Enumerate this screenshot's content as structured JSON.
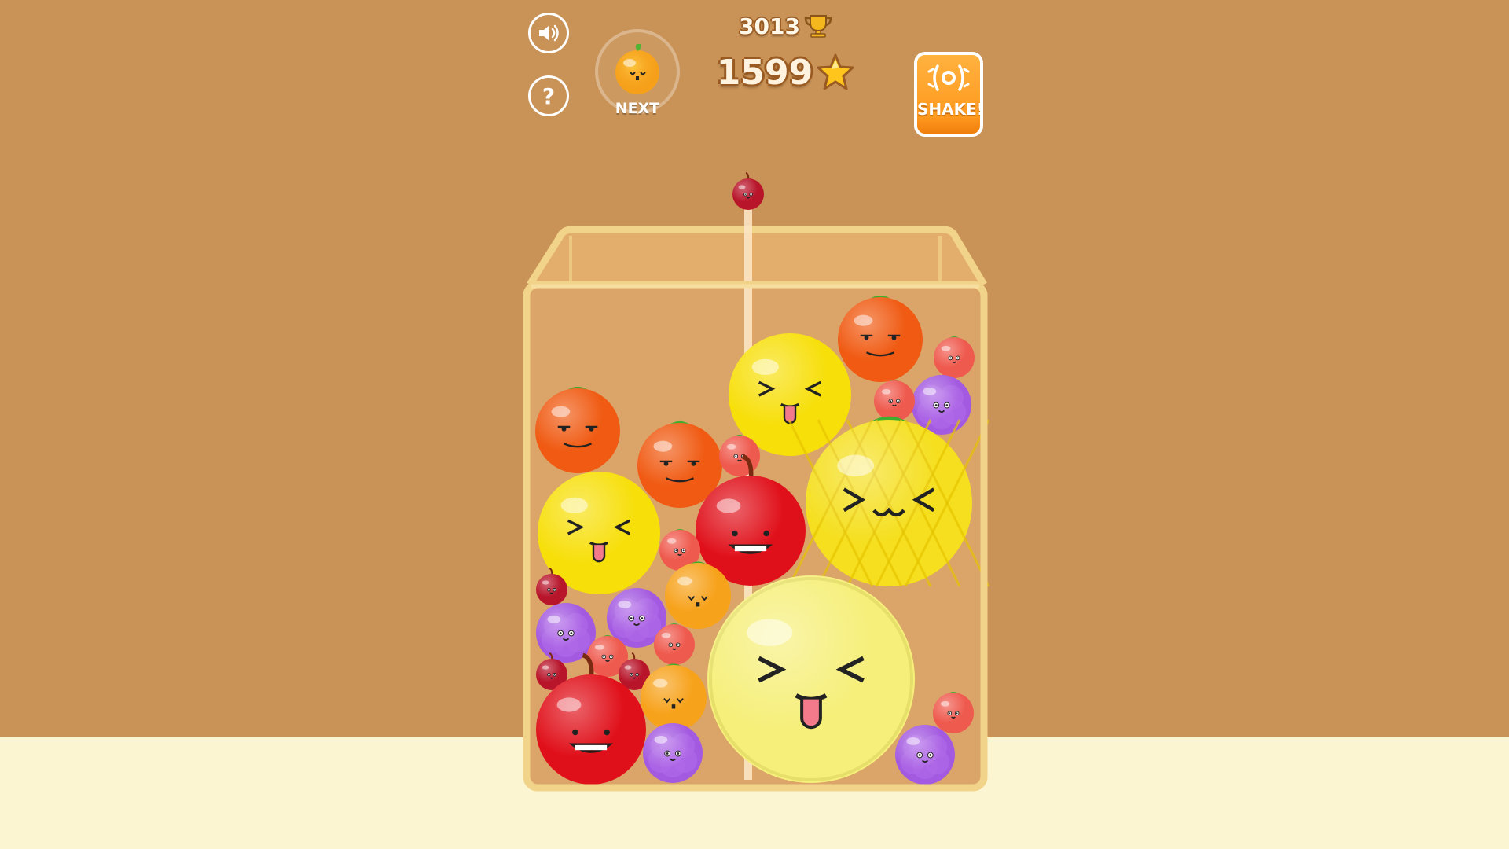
{
  "hud": {
    "best_score": "3013",
    "score": "1599",
    "next_label": "NEXT",
    "next_fruit": "orange",
    "shake_label": "SHAKE!",
    "sound_icon": "speaker-icon",
    "help_icon": "question-icon"
  },
  "dropper": {
    "fruit": "cherry"
  },
  "jar": {
    "fruits": [
      {
        "kind": "orange",
        "face": "smug"
      },
      {
        "kind": "orange",
        "face": "smug"
      },
      {
        "kind": "lemon",
        "face": "tongue"
      },
      {
        "kind": "orange",
        "face": "smug"
      },
      {
        "kind": "strawberry",
        "face": "happy"
      },
      {
        "kind": "grape",
        "face": "happy"
      },
      {
        "kind": "strawberry",
        "face": "happy"
      },
      {
        "kind": "strawberry",
        "face": "happy"
      },
      {
        "kind": "lemon",
        "face": "tongue"
      },
      {
        "kind": "apple",
        "face": "grin"
      },
      {
        "kind": "pineapple",
        "face": "squint"
      },
      {
        "kind": "strawberry",
        "face": "happy"
      },
      {
        "kind": "cherry",
        "face": "happy"
      },
      {
        "kind": "tangerine",
        "face": "heart"
      },
      {
        "kind": "grape",
        "face": "happy"
      },
      {
        "kind": "grape",
        "face": "happy"
      },
      {
        "kind": "strawberry",
        "face": "happy"
      },
      {
        "kind": "strawberry",
        "face": "happy"
      },
      {
        "kind": "cherry",
        "face": "happy"
      },
      {
        "kind": "cherry",
        "face": "happy"
      },
      {
        "kind": "tangerine",
        "face": "heart"
      },
      {
        "kind": "apple",
        "face": "grin"
      },
      {
        "kind": "melon",
        "face": "tongue"
      },
      {
        "kind": "grape",
        "face": "happy"
      },
      {
        "kind": "grape",
        "face": "happy"
      },
      {
        "kind": "strawberry",
        "face": "happy"
      }
    ]
  },
  "colors": {
    "background": "#c99256",
    "floor": "#fcf5d2",
    "jar_rim": "#f2d38a",
    "shake_button": "#ff9a1f"
  }
}
